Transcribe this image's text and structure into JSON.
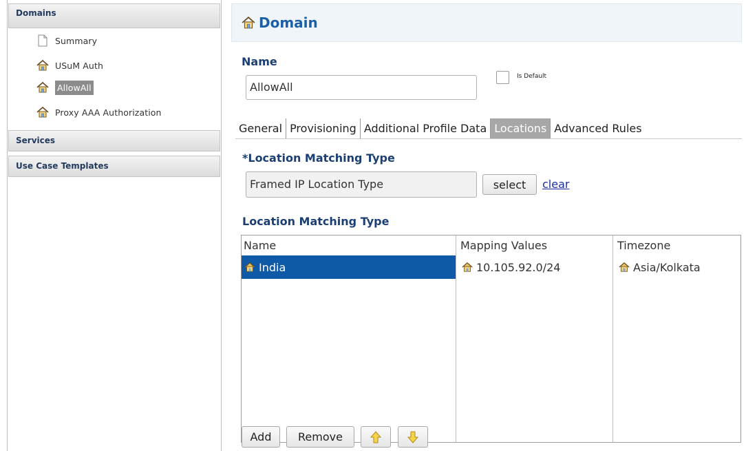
{
  "sidebar": {
    "sections": {
      "domains": "Domains",
      "services": "Services",
      "use_case_templates": "Use Case Templates"
    },
    "items": [
      {
        "label": "Summary",
        "icon": "document-icon"
      },
      {
        "label": "USuM Auth",
        "icon": "house-icon"
      },
      {
        "label": "AllowAll",
        "icon": "house-icon",
        "selected": true
      },
      {
        "label": "Proxy AAA Authorization",
        "icon": "house-icon"
      }
    ]
  },
  "header": {
    "title": "Domain",
    "icon": "house-icon"
  },
  "form": {
    "name_label": "Name",
    "name_value": "AllowAll",
    "is_default_label": "Is Default",
    "is_default_checked": false
  },
  "tabs": [
    {
      "label": "General"
    },
    {
      "label": "Provisioning"
    },
    {
      "label": "Additional Profile Data"
    },
    {
      "label": "Locations",
      "active": true
    },
    {
      "label": "Advanced Rules"
    }
  ],
  "locations": {
    "matching_type_label": "*Location Matching Type",
    "matching_type_value": "Framed IP Location Type",
    "select_label": "select",
    "clear_label": "clear",
    "table_title": "Location Matching Type",
    "columns": [
      "Name",
      "Mapping Values",
      "Timezone"
    ],
    "rows": [
      {
        "name": "India",
        "mapping": "10.105.92.0/24",
        "timezone": "Asia/Kolkata",
        "selected": true
      }
    ],
    "buttons": {
      "add": "Add",
      "remove": "Remove",
      "up": "up-arrow-icon",
      "down": "down-arrow-icon"
    }
  },
  "colors": {
    "accent": "#1d5fa6",
    "selection": "#0f5aa6",
    "active_tab": "#a7a7a7",
    "selected_tree_item": "#8c8c8c"
  }
}
